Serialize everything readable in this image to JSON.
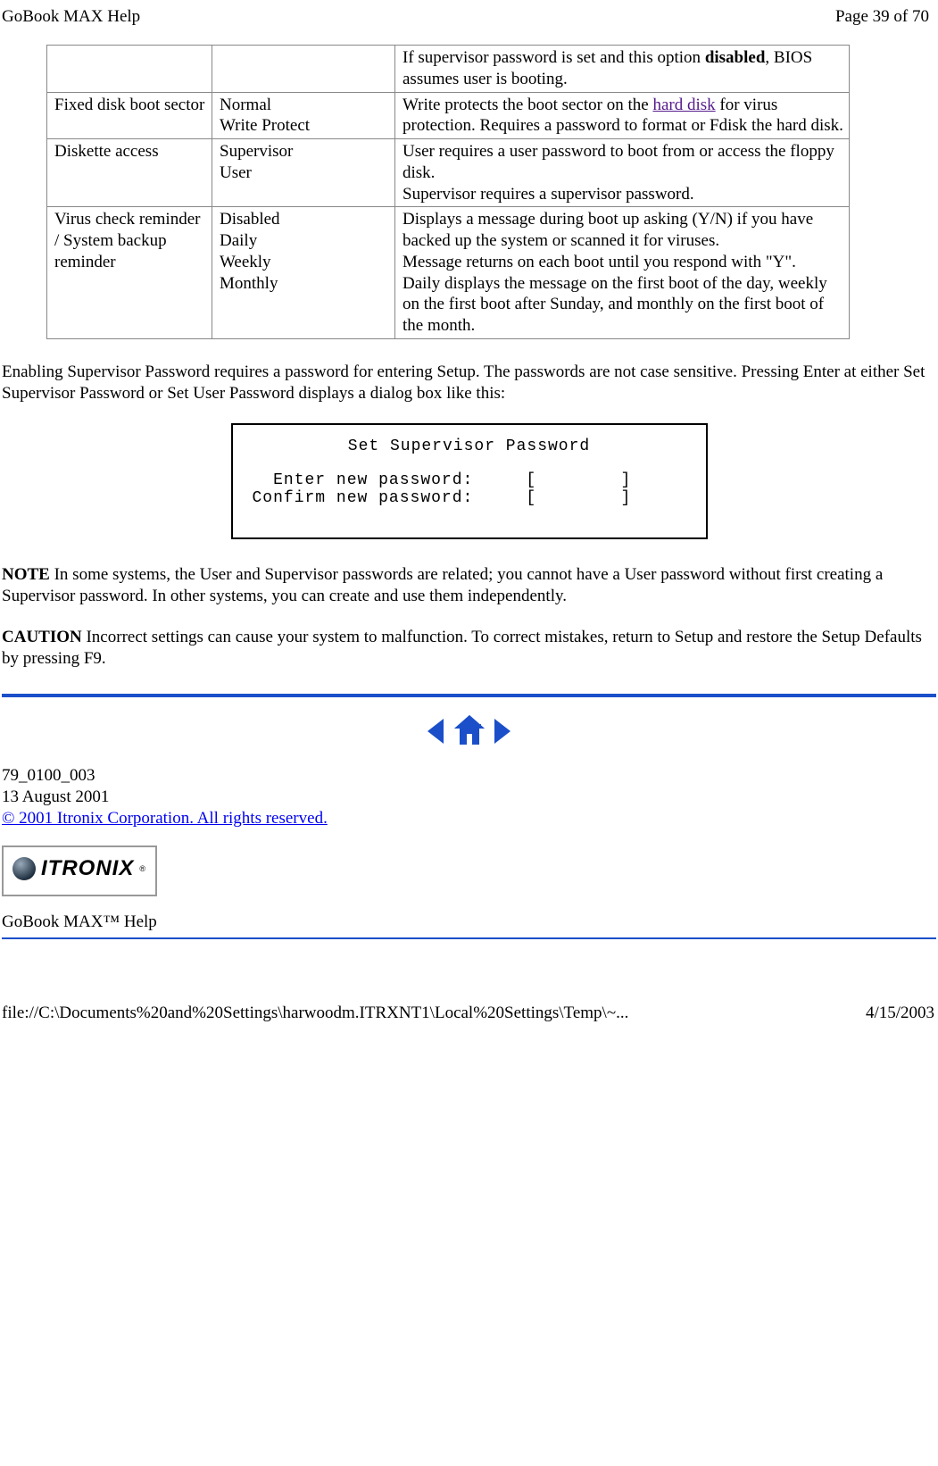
{
  "header": {
    "title": "GoBook MAX Help",
    "page_indicator": "Page 39 of 70"
  },
  "table": {
    "rows": [
      {
        "c1": "",
        "c2": "",
        "c3_prefix": "If supervisor password is set and this option ",
        "c3_bold": "disabled",
        "c3_suffix": ", BIOS assumes user is booting."
      },
      {
        "c1": "Fixed disk boot sector",
        "c2": "Normal\nWrite Protect",
        "c3_prefix": "Write protects the boot sector on the ",
        "c3_link": "hard disk",
        "c3_suffix": " for virus protection.  Requires a password to format or Fdisk the hard disk."
      },
      {
        "c1": "Diskette access",
        "c2": "Supervisor\nUser",
        "c3": "User requires a user password to boot from or access the floppy disk.\nSupervisor requires a supervisor password."
      },
      {
        "c1": "Virus check reminder / System backup reminder",
        "c2": "Disabled\nDaily\nWeekly\nMonthly",
        "c3": "Displays a message during boot up asking (Y/N) if you have backed up the system or scanned it for viruses.\nMessage returns on each boot until you respond with \"Y\".\nDaily displays the message on the first boot of the day, weekly on the first boot after Sunday, and monthly on the first boot of the month."
      }
    ]
  },
  "para1": "Enabling Supervisor Password requires a password for entering Setup.  The passwords are not case sensitive.  Pressing Enter at either Set Supervisor Password or Set User Password displays a dialog box like this:",
  "dialog": {
    "title": "Set Supervisor Password",
    "line1": "  Enter new password:     [        ]",
    "line2": "Confirm new password:     [        ]"
  },
  "note_label": "NOTE",
  "note_body": "  In some systems, the User and Supervisor passwords are related; you cannot have a User password without first creating a Supervisor password.  In other systems, you can create and use them independently.",
  "caution_label": "CAUTION",
  "caution_body": "  Incorrect settings can cause your system to malfunction.  To correct mistakes, return to Setup and restore the Setup Defaults by pressing F9.",
  "meta": {
    "docnum": "79_0100_003",
    "date": "13 August 2001",
    "copyright": "© 2001 Itronix Corporation.  All rights reserved."
  },
  "logo": {
    "text": "ITRONIX"
  },
  "subheader": " GoBook MAX™ Help",
  "footer": {
    "path": "file://C:\\Documents%20and%20Settings\\harwoodm.ITRXNT1\\Local%20Settings\\Temp\\~...",
    "date": "4/15/2003"
  }
}
